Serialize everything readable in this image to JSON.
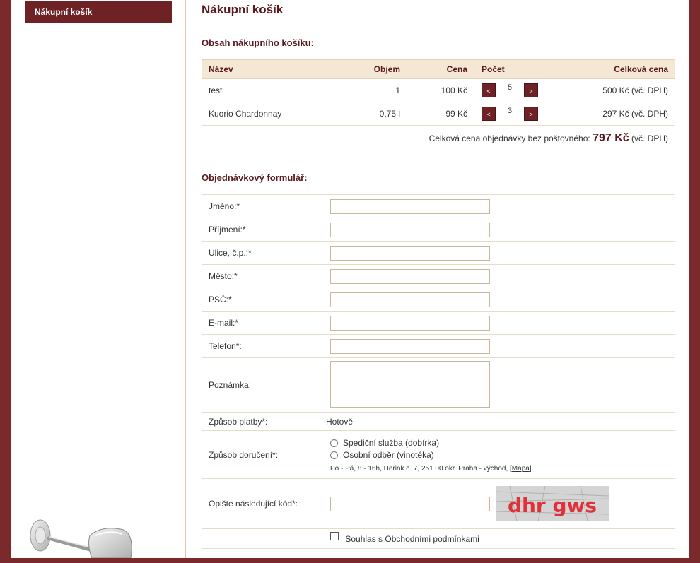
{
  "sidebar": {
    "items": [
      {
        "label": "Nákupní košík"
      }
    ]
  },
  "page": {
    "title": "Nákupní košík",
    "cart_heading": "Obsah nákupního košíku:",
    "form_heading": "Objednávkový formulář:"
  },
  "cart": {
    "columns": {
      "name": "Název",
      "volume": "Objem",
      "price": "Cena",
      "quantity": "Počet",
      "total": "Celková cena"
    },
    "decrement_label": "<",
    "increment_label": ">",
    "rows": [
      {
        "name": "test",
        "volume": "1",
        "price": "100 Kč",
        "quantity": "5",
        "total": "500 Kč (vč. DPH)"
      },
      {
        "name": "Kuorio Chardonnay",
        "volume": "0,75 l",
        "price": "99 Kč",
        "quantity": "3",
        "total": "297 Kč (vč. DPH)"
      }
    ],
    "summary_label": "Celková cena objednávky bez poštovného:",
    "summary_amount": "797 Kč",
    "summary_suffix": "(vč. DPH)"
  },
  "form": {
    "fields": {
      "first_name": {
        "label": "Jméno:*",
        "value": ""
      },
      "last_name": {
        "label": "Příjmení:*",
        "value": ""
      },
      "street": {
        "label": "Ulice, č.p.:*",
        "value": ""
      },
      "city": {
        "label": "Město:*",
        "value": ""
      },
      "zip": {
        "label": "PSČ:*",
        "value": ""
      },
      "email": {
        "label": "E-mail:*",
        "value": ""
      },
      "phone": {
        "label": "Telefon*:",
        "value": ""
      },
      "note": {
        "label": "Poznámka:",
        "value": ""
      }
    },
    "payment": {
      "label": "Způsob platby*:",
      "value": "Hotově"
    },
    "delivery": {
      "label": "Způsob doručení*:",
      "options": [
        "Spediční služba (dobírka)",
        "Osobní odběr (vinotéka)"
      ],
      "address_note": "Po - Pá, 8 - 16h, Herink č. 7, 251 00 okr. Praha - východ, [",
      "map_link": "Mapa",
      "address_note_end": "]."
    },
    "captcha": {
      "label": "Opište následující kód*:",
      "code": "dhr gws",
      "value": ""
    },
    "terms": {
      "prefix": "Souhlas s",
      "link": "Obchodními podmínkami"
    }
  },
  "colors": {
    "brand": "#6e2226",
    "outer": "#7a2a2a",
    "header_bg": "#f4e7d3",
    "captcha_text": "#e0303a"
  }
}
